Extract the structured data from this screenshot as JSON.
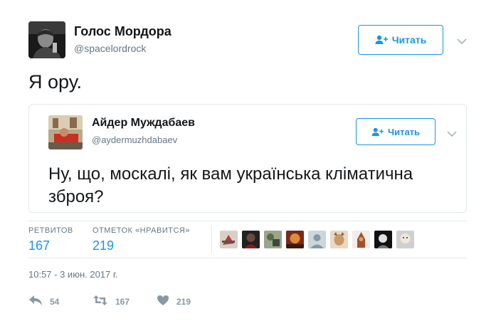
{
  "tweet": {
    "author_name": "Голос Мордора",
    "author_handle": "@spacelordrock",
    "follow_label": "Читать",
    "text": "Я ору."
  },
  "quoted": {
    "author_name": "Айдер Муждабаев",
    "author_handle": "@aydermuzhdabaev",
    "follow_label": "Читать",
    "text": "Ну, що, москалі, як вам українська кліматична зброя?"
  },
  "stats": {
    "retweets_label": "РЕТВИТОВ",
    "retweets_value": "167",
    "likes_label": "ОТМЕТОК «НРАВИТСЯ»",
    "likes_value": "219"
  },
  "timestamp": "10:57 - 3 июн. 2017 г.",
  "actions": {
    "reply_count": "54",
    "retweet_count": "167",
    "like_count": "219"
  },
  "colors": {
    "accent": "#1b95e0",
    "muted": "#657786",
    "action_icon": "#8899a6",
    "border": "#e1e8ed"
  },
  "icons": [
    "add-user-icon",
    "chevron-down-icon",
    "reply-icon",
    "retweet-icon",
    "heart-icon"
  ]
}
